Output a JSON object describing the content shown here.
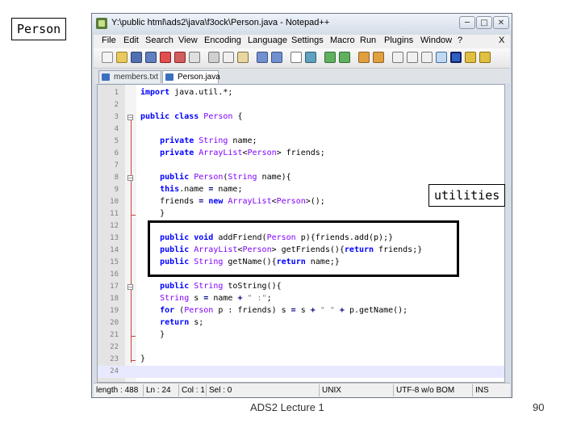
{
  "labels": {
    "person": "Person",
    "utilities": "utilities"
  },
  "window": {
    "title": "Y:\\public html\\ads2\\java\\f3ock\\Person.java - Notepad++",
    "buttons": {
      "minimize": "─",
      "maximize": "□",
      "close": "✕"
    }
  },
  "menu": [
    "File",
    "Edit",
    "Search",
    "View",
    "Encoding",
    "Language",
    "Settings",
    "Macro",
    "Run",
    "Plugins",
    "Window",
    "?",
    "X"
  ],
  "tabs": [
    {
      "label": "members.txt",
      "active": false
    },
    {
      "label": "Person.java",
      "active": true
    }
  ],
  "code": {
    "current_line": 24,
    "lines": [
      {
        "n": "1",
        "text": "import java.util.*;"
      },
      {
        "n": "2",
        "text": ""
      },
      {
        "n": "3",
        "text": "public class Person {"
      },
      {
        "n": "4",
        "text": ""
      },
      {
        "n": "5",
        "text": "    private String name;"
      },
      {
        "n": "6",
        "text": "    private ArrayList<Person> friends;"
      },
      {
        "n": "7",
        "text": ""
      },
      {
        "n": "8",
        "text": "    public Person(String name){"
      },
      {
        "n": "9",
        "text": "    this.name = name;"
      },
      {
        "n": "10",
        "text": "    friends = new ArrayList<Person>();"
      },
      {
        "n": "11",
        "text": "    }"
      },
      {
        "n": "12",
        "text": ""
      },
      {
        "n": "13",
        "text": "    public void addFriend(Person p){friends.add(p);}"
      },
      {
        "n": "14",
        "text": "    public ArrayList<Person> getFriends(){return friends;}"
      },
      {
        "n": "15",
        "text": "    public String getName(){return name;}"
      },
      {
        "n": "16",
        "text": ""
      },
      {
        "n": "17",
        "text": "    public String toString(){"
      },
      {
        "n": "18",
        "text": "    String s = name + \" :\";"
      },
      {
        "n": "19",
        "text": "    for (Person p : friends) s = s + \" \" + p.getName();"
      },
      {
        "n": "20",
        "text": "    return s;"
      },
      {
        "n": "21",
        "text": "    }"
      },
      {
        "n": "22",
        "text": ""
      },
      {
        "n": "23",
        "text": "}"
      },
      {
        "n": "24",
        "text": ""
      }
    ]
  },
  "status": {
    "length": "length : 488",
    "ln": "Ln : 24",
    "col": "Col : 1",
    "sel": "Sel : 0",
    "eol": "UNIX",
    "encoding": "UTF-8 w/o BOM",
    "mode": "INS"
  },
  "footer": {
    "title": "ADS2 Lecture 1",
    "page": "90"
  }
}
